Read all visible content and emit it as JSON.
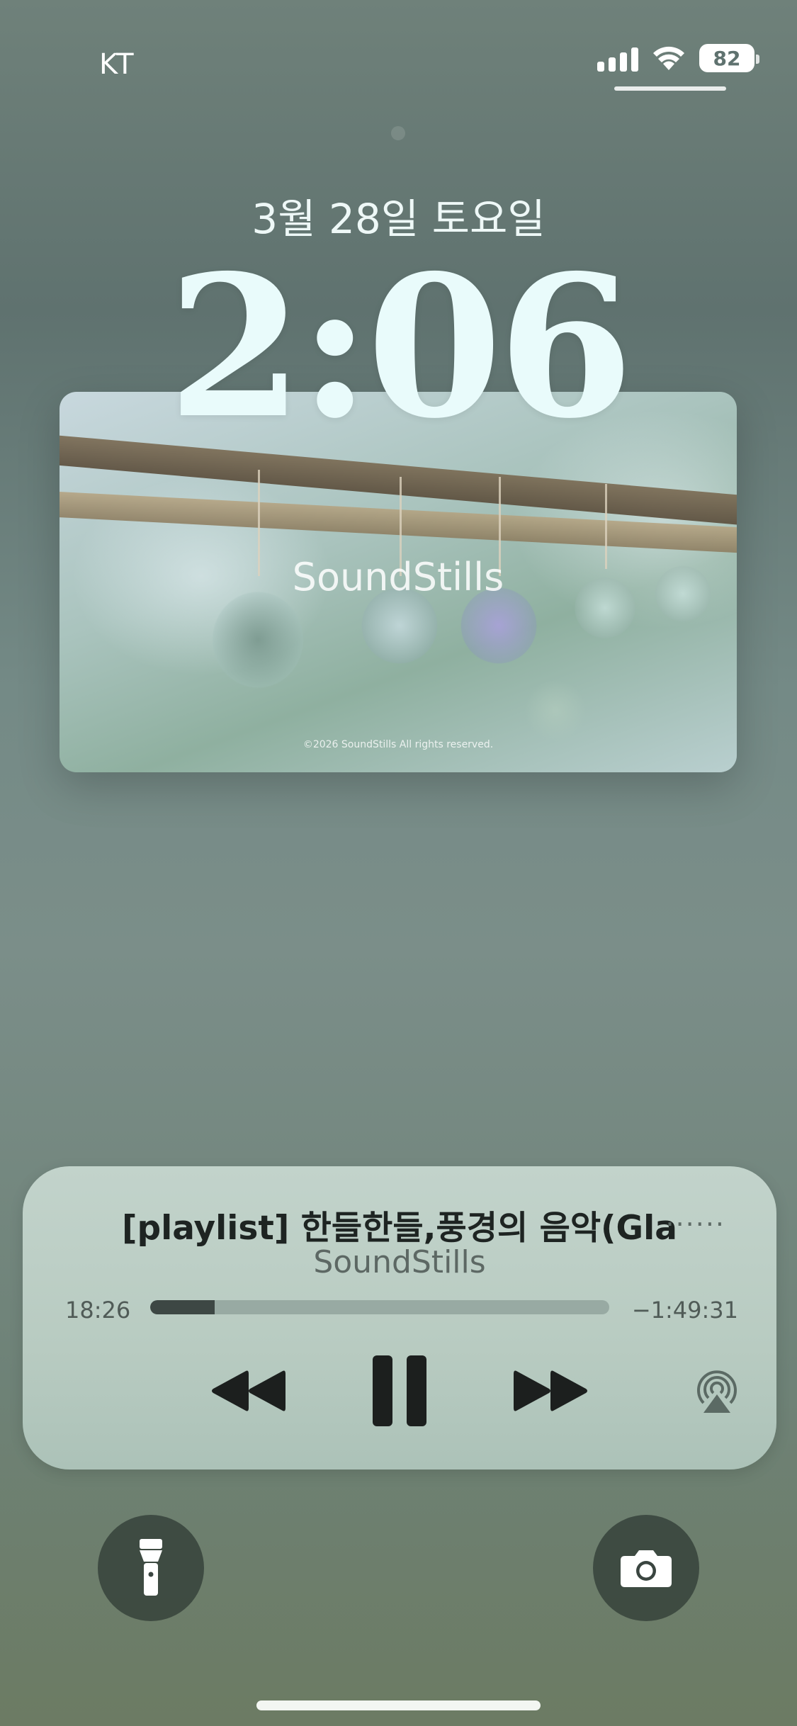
{
  "status_bar": {
    "carrier": "KT",
    "battery": "82",
    "signal_icon": "cellular-signal-icon",
    "wifi_icon": "wifi-icon"
  },
  "lock_screen": {
    "date": "3월 28일 토요일",
    "time": "2:06"
  },
  "wallpaper_photo": {
    "brand": "SoundStills",
    "copyright": "©2026 SoundStills All rights reserved."
  },
  "now_playing": {
    "title": "[playlist] 한들한들,풍경의 음악(Gla",
    "artist": "SoundStills",
    "elapsed": "18:26",
    "remaining": "−1:49:31",
    "progress_fraction": 0.14,
    "controls": {
      "rewind_icon": "rewind-icon",
      "pause_icon": "pause-icon",
      "fast_forward_icon": "fast-forward-icon",
      "airplay_icon": "airplay-icon"
    }
  },
  "quick_actions": {
    "flashlight_icon": "flashlight-icon",
    "camera_icon": "camera-icon"
  }
}
